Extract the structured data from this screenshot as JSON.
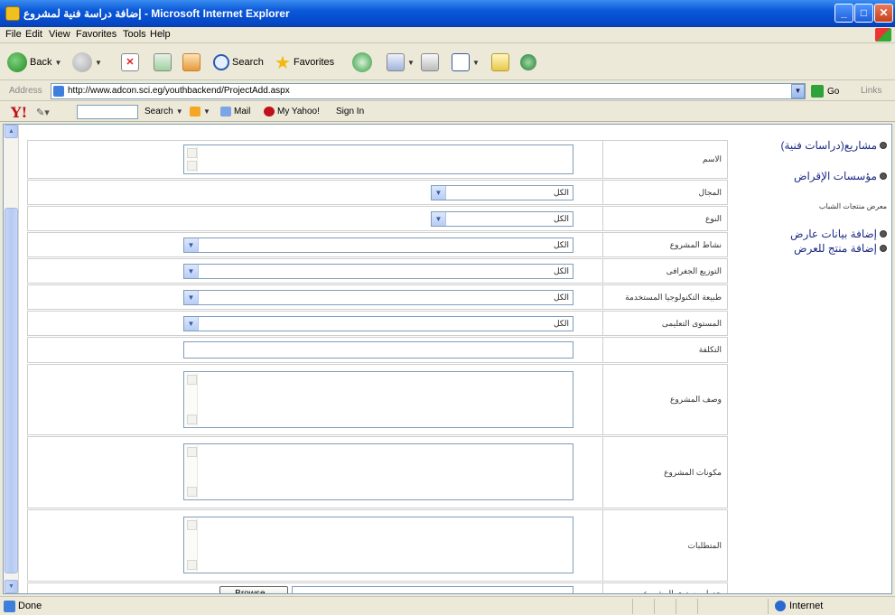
{
  "window": {
    "title": "إضافة دراسة فنية لمشروع - Microsoft Internet Explorer",
    "minimize": "_",
    "maximize": "□",
    "close": "✕"
  },
  "menu": [
    "File",
    "Edit",
    "View",
    "Favorites",
    "Tools",
    "Help"
  ],
  "toolbar": {
    "back": "Back",
    "search": "Search",
    "favorites": "Favorites"
  },
  "address": {
    "label": "Address",
    "url": "http://www.adcon.sci.eg/youthbackend/ProjectAdd.aspx",
    "go": "Go",
    "links": "Links"
  },
  "yahoo": {
    "logo": "Y!",
    "search": "Search",
    "mail": "Mail",
    "my_yahoo": "My Yahoo!",
    "sign_in": "Sign In"
  },
  "form": {
    "rows": [
      {
        "label": "الاسم"
      },
      {
        "label": "المجال",
        "value": "الكل"
      },
      {
        "label": "النوع",
        "value": "الكل"
      },
      {
        "label": "نشاط المشروع",
        "value": "الكل"
      },
      {
        "label": "التوزيع الجغرافى",
        "value": "الكل"
      },
      {
        "label": "طبيعة التكنولوجيا المستخدمة",
        "value": "الكل"
      },
      {
        "label": "المستوى التعليمى",
        "value": "الكل"
      },
      {
        "label": "التكلفة"
      },
      {
        "label": "وصف المشروع"
      },
      {
        "label": "مكونات المشروع"
      },
      {
        "label": "المتطلبات"
      },
      {
        "label": "جدول مستوى المشروع",
        "button": "Browse..."
      }
    ]
  },
  "sidebar": {
    "items": [
      "مشاريع(دراسات فنية)",
      "مؤسسات الإقراض"
    ],
    "note": "معرض منتجات الشباب",
    "items2": [
      "إضافة بيانات عارض",
      "إضافة منتج للعرض"
    ]
  },
  "status": {
    "done": "Done",
    "zone": "Internet"
  }
}
